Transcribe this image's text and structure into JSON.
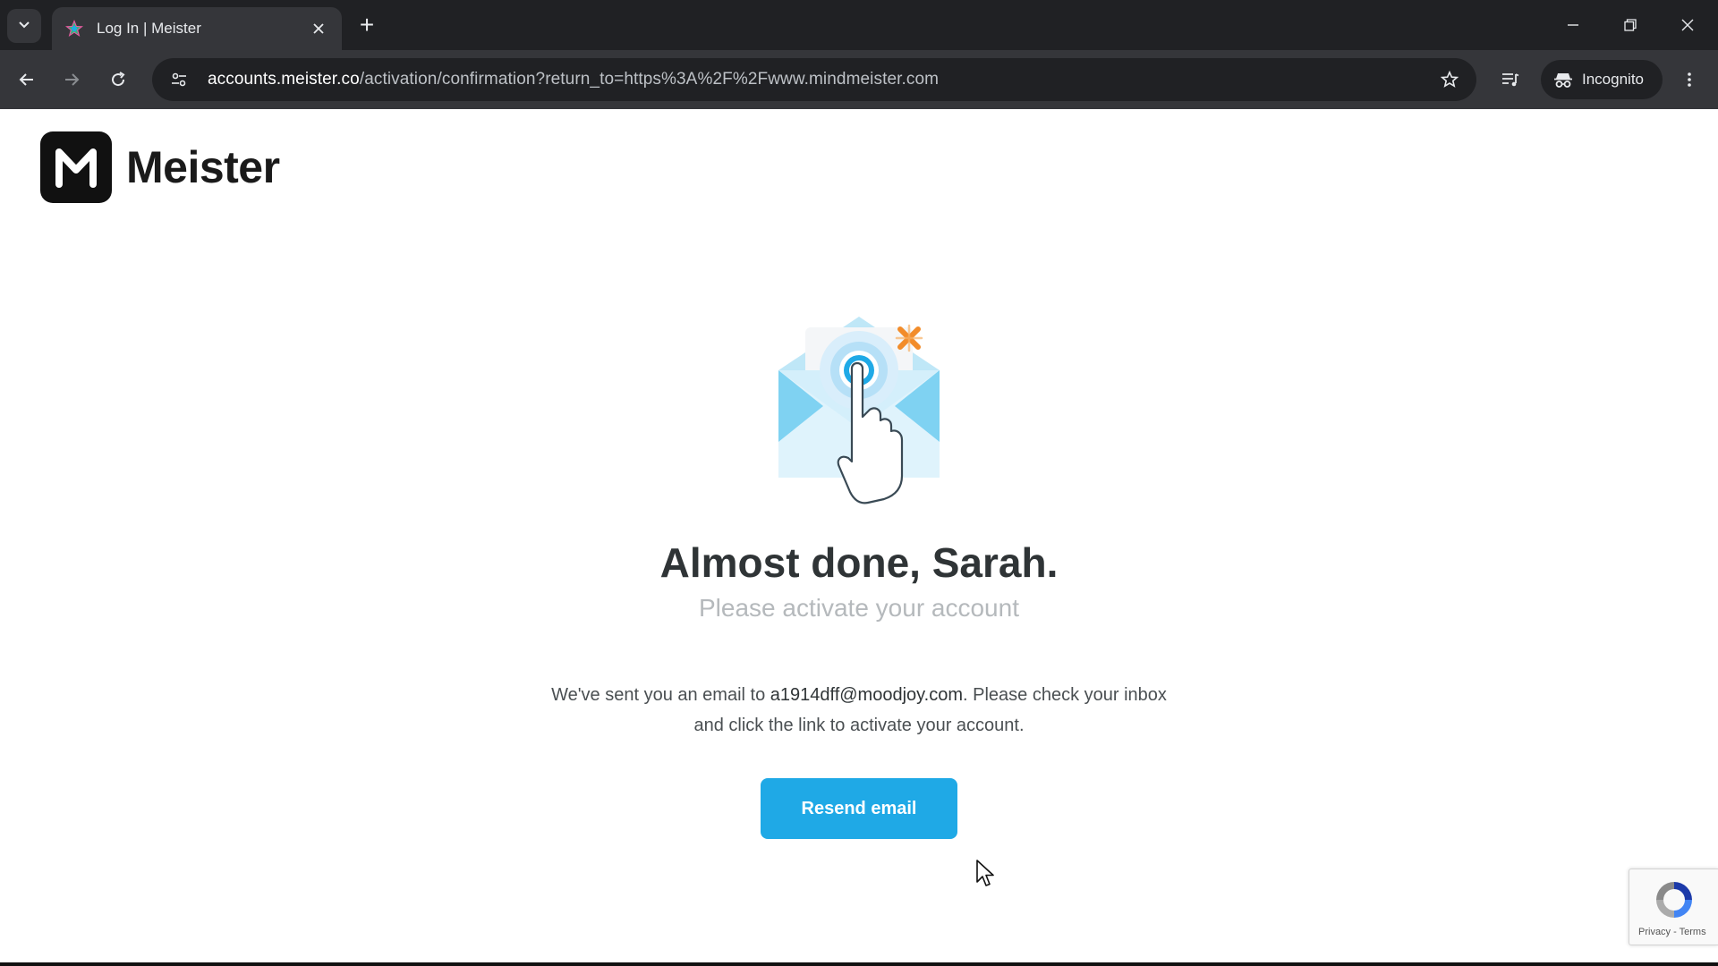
{
  "browser": {
    "tab": {
      "title": "Log In | Meister",
      "favicon": "meister-favicon"
    },
    "new_tab_label": "+",
    "address": {
      "host": "accounts.meister.co",
      "path": "/activation/confirmation?return_to=https%3A%2F%2Fwww.mindmeister.com"
    },
    "incognito_label": "Incognito",
    "icons": {
      "tab_search": "chevron-down-icon",
      "tab_close": "close-icon",
      "back": "back-arrow-icon",
      "forward": "forward-arrow-icon",
      "reload": "reload-icon",
      "site_info": "tune-icon",
      "bookmark": "star-icon",
      "media": "media-control-icon",
      "incognito": "incognito-icon",
      "menu": "kebab-menu-icon",
      "minimize": "minimize-icon",
      "restore": "restore-icon",
      "close_window": "close-icon"
    }
  },
  "page": {
    "brand": {
      "logo_letter": "M",
      "name": "Meister"
    },
    "headline": "Almost done, Sarah.",
    "subheadline": "Please activate your account",
    "message": {
      "before": "We've sent you an email to ",
      "email": "a1914dff@moodjoy.com",
      "after": ". Please check your inbox and click the link to activate your account."
    },
    "resend_button": "Resend email",
    "recaptcha": {
      "privacy": "Privacy",
      "separator": " - ",
      "terms": "Terms"
    }
  },
  "colors": {
    "accent": "#1fa9e6",
    "headline": "#2f3436",
    "subheadline": "#b5b9bc",
    "chrome_dark": "#202124",
    "chrome_toolbar": "#35363a"
  }
}
